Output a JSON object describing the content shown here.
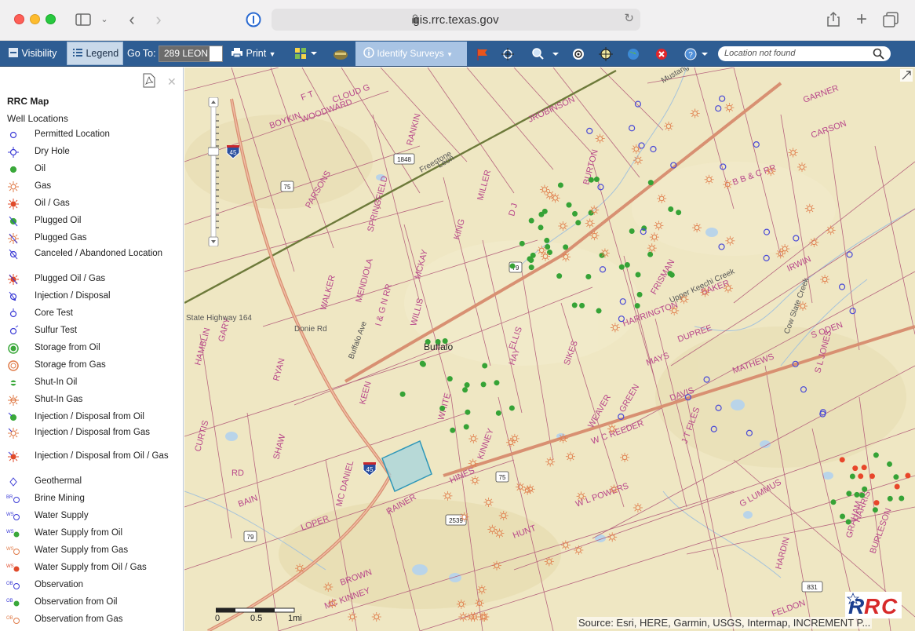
{
  "browser": {
    "url": "gis.rrc.texas.gov"
  },
  "toolbar": {
    "visibility": "Visibility",
    "legend": "Legend",
    "goto_label": "Go To:",
    "goto_value": "289 LEON",
    "print": "Print",
    "identify": "Identify Surveys",
    "search_placeholder": "Location not found"
  },
  "sidebar": {
    "title": "RRC Map",
    "subtitle": "Well Locations",
    "items": [
      {
        "label": "Permitted Location",
        "icon": "permitted-location-icon"
      },
      {
        "label": "Dry Hole",
        "icon": "dry-hole-icon"
      },
      {
        "label": "Oil",
        "icon": "oil-icon"
      },
      {
        "label": "Gas",
        "icon": "gas-icon"
      },
      {
        "label": "Oil / Gas",
        "icon": "oil-gas-icon"
      },
      {
        "label": "Plugged Oil",
        "icon": "plugged-oil-icon"
      },
      {
        "label": "Plugged Gas",
        "icon": "plugged-gas-icon"
      },
      {
        "label": "Canceled / Abandoned Location",
        "icon": "canceled-location-icon"
      },
      {
        "label": "Plugged Oil / Gas",
        "icon": "plugged-oil-gas-icon"
      },
      {
        "label": "Injection / Disposal",
        "icon": "injection-disposal-icon"
      },
      {
        "label": "Core Test",
        "icon": "core-test-icon"
      },
      {
        "label": "Sulfur Test",
        "icon": "sulfur-test-icon"
      },
      {
        "label": "Storage from Oil",
        "icon": "storage-oil-icon"
      },
      {
        "label": "Storage from Gas",
        "icon": "storage-gas-icon"
      },
      {
        "label": "Shut-In Oil",
        "icon": "shut-in-oil-icon"
      },
      {
        "label": "Shut-In Gas",
        "icon": "shut-in-gas-icon"
      },
      {
        "label": "Injection / Disposal from Oil",
        "icon": "injection-oil-icon"
      },
      {
        "label": "Injection / Disposal from Gas",
        "icon": "injection-gas-icon"
      },
      {
        "label": "Injection / Disposal from Oil / Gas",
        "icon": "injection-oil-gas-icon"
      },
      {
        "label": "Geothermal",
        "icon": "geothermal-icon"
      },
      {
        "label": "Brine Mining",
        "icon": "brine-mining-icon"
      },
      {
        "label": "Water Supply",
        "icon": "water-supply-icon"
      },
      {
        "label": "Water Supply from Oil",
        "icon": "water-supply-oil-icon"
      },
      {
        "label": "Water Supply from Gas",
        "icon": "water-supply-gas-icon"
      },
      {
        "label": "Water Supply from Oil / Gas",
        "icon": "water-supply-oil-gas-icon"
      },
      {
        "label": "Observation",
        "icon": "observation-icon"
      },
      {
        "label": "Observation from Oil",
        "icon": "observation-oil-icon"
      },
      {
        "label": "Observation from Gas",
        "icon": "observation-gas-icon"
      }
    ]
  },
  "map": {
    "city_label": "Buffalo",
    "road_labels": [
      "Donie Rd",
      "Freestone",
      "Leon",
      "State Highway 164",
      "Buffalo Ave",
      "Mustang Creek",
      "Cow Slate Creek",
      "Upper Keechi Creek"
    ],
    "highway_shields": [
      "45",
      "75",
      "79",
      "1848",
      "2539",
      "831"
    ],
    "survey_labels": [
      "BOYKIN",
      "WOODWARD",
      "F T",
      "RANKIN",
      "JROBINSON",
      "BURTON",
      "PARSONS",
      "SPRINGFIELD",
      "MILLER",
      "KING",
      "D J",
      "CLOUD G",
      "GARNER",
      "CARSON",
      "B B & C RR",
      "WALKER",
      "MENDIOLA",
      "I & G N RR",
      "MCKAY",
      "WILLIS",
      "FRISMAN",
      "IRWIN",
      "BAKER",
      "HARRINGTON",
      "DUPREE",
      "S ODEN",
      "S L JONES",
      "MAYS",
      "DAVIS",
      "MATHEWS",
      "GREEN",
      "WEAVER",
      "SIKES",
      "ELLIS",
      "HAY",
      "KINNEY",
      "HINES",
      "MC DANIEL",
      "SHAW",
      "CURTIS",
      "RD",
      "BAIN",
      "LOPER",
      "MC KINNEY",
      "BROWN",
      "RAINER",
      "HUNT",
      "W L POWERS",
      "W C REEDER",
      "J T FILES",
      "G LUMMUS",
      "HARRIS",
      "BURLESON",
      "GRAHAM",
      "HARDIN",
      "FELDON",
      "HAMBLIN",
      "GARY",
      "RYAN",
      "WHITE",
      "KEEN"
    ],
    "scale_labels": [
      "0",
      "0.5",
      "1mi"
    ],
    "attribution": "Source: Esri, HERE, Garmin, USGS, Intermap, INCREMENT P...",
    "logo_text": "RRC"
  }
}
